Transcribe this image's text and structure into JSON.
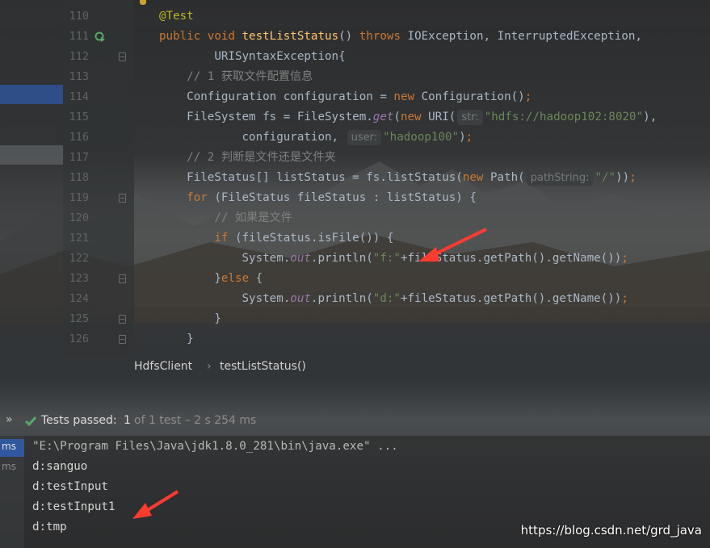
{
  "editor": {
    "lines": [
      {
        "num": "110",
        "segments": [
          [
            "an",
            "@Test"
          ]
        ]
      },
      {
        "num": "111",
        "segments": [
          [
            "kw",
            "public "
          ],
          [
            "kw",
            "void "
          ],
          [
            "fn",
            "testListStatus"
          ],
          [
            "",
            "() "
          ],
          [
            "kw",
            "throws "
          ],
          [
            "",
            "IOException, InterruptedException,"
          ]
        ]
      },
      {
        "num": "112",
        "segments": [
          [
            "",
            "        URISyntaxException{"
          ]
        ]
      },
      {
        "num": "113",
        "segments": [
          [
            "cm",
            "    // 1 获取文件配置信息"
          ]
        ]
      },
      {
        "num": "114",
        "segments": [
          [
            "",
            "    Configuration configuration = "
          ],
          [
            "kw",
            "new "
          ],
          [
            "",
            "Configuration()"
          ],
          [
            "kw",
            ";"
          ]
        ]
      },
      {
        "num": "115",
        "segments": [
          [
            "",
            "    FileSystem fs = FileSystem."
          ],
          [
            "it",
            "get"
          ],
          [
            "",
            "("
          ],
          [
            "kw",
            "new "
          ],
          [
            "",
            "URI("
          ],
          [
            "hint",
            "str:"
          ],
          [
            "str",
            "\"hdfs://hadoop102:8020\""
          ],
          [
            "",
            "),"
          ]
        ]
      },
      {
        "num": "116",
        "segments": [
          [
            "",
            "            configuration, "
          ],
          [
            "hint",
            "user:"
          ],
          [
            "str",
            "\"hadoop100\""
          ],
          [
            "",
            ")"
          ],
          [
            "kw",
            ";"
          ]
        ]
      },
      {
        "num": "117",
        "segments": [
          [
            "cm",
            "    // 2 判断是文件还是文件夹"
          ]
        ]
      },
      {
        "num": "118",
        "segments": [
          [
            "",
            "    FileStatus[] listStatus = fs.listStatus("
          ],
          [
            "kw",
            "new "
          ],
          [
            "",
            "Path("
          ],
          [
            "hint",
            "pathString:"
          ],
          [
            "str",
            "\"/\""
          ],
          [
            "",
            "))"
          ],
          [
            "kw",
            ";"
          ]
        ]
      },
      {
        "num": "119",
        "segments": [
          [
            "kw",
            "    for "
          ],
          [
            "",
            "(FileStatus fileStatus : listStatus) {"
          ]
        ]
      },
      {
        "num": "120",
        "segments": [
          [
            "cm",
            "        // 如果是文件"
          ]
        ]
      },
      {
        "num": "121",
        "segments": [
          [
            "kw",
            "        if "
          ],
          [
            "",
            "(fileStatus.isFile()) {"
          ]
        ]
      },
      {
        "num": "122",
        "segments": [
          [
            "",
            "            System."
          ],
          [
            "it",
            "out"
          ],
          [
            "",
            ".println("
          ],
          [
            "str",
            "\"f:\""
          ],
          [
            "",
            "+fileStatus.getPath().getName())"
          ],
          [
            "kw",
            ";"
          ]
        ]
      },
      {
        "num": "123",
        "segments": [
          [
            "",
            "        }"
          ],
          [
            "kw",
            "else "
          ],
          [
            "",
            "{"
          ]
        ]
      },
      {
        "num": "124",
        "segments": [
          [
            "",
            "            System."
          ],
          [
            "it",
            "out"
          ],
          [
            "",
            ".println("
          ],
          [
            "str",
            "\"d:\""
          ],
          [
            "",
            "+fileStatus.getPath().getName())"
          ],
          [
            "kw",
            ";"
          ]
        ]
      },
      {
        "num": "125",
        "segments": [
          [
            "",
            "        }"
          ]
        ]
      },
      {
        "num": "126",
        "segments": [
          [
            "",
            "    }"
          ]
        ]
      }
    ]
  },
  "breadcrumb": {
    "class_name": "HdfsClient",
    "separator": "›",
    "method_name": "testListStatus()"
  },
  "test_bar": {
    "expand": "»",
    "status_label": "Tests passed:",
    "count": "1",
    "detail": "of 1 test – 2 s 254 ms"
  },
  "console": {
    "side_top": "ms",
    "side_second": "ms",
    "lines": [
      "\"E:\\Program Files\\Java\\jdk1.8.0_281\\bin\\java.exe\" ...",
      "d:sanguo",
      "d:testInput",
      "d:testInput1",
      "d:tmp"
    ]
  },
  "watermark": "https://blog.csdn.net/grd_java",
  "colors": {
    "keyword": "#cc7832",
    "string": "#6a8759",
    "comment": "#808080",
    "pass": "#59a869",
    "arrow": "#ff3b2f"
  }
}
